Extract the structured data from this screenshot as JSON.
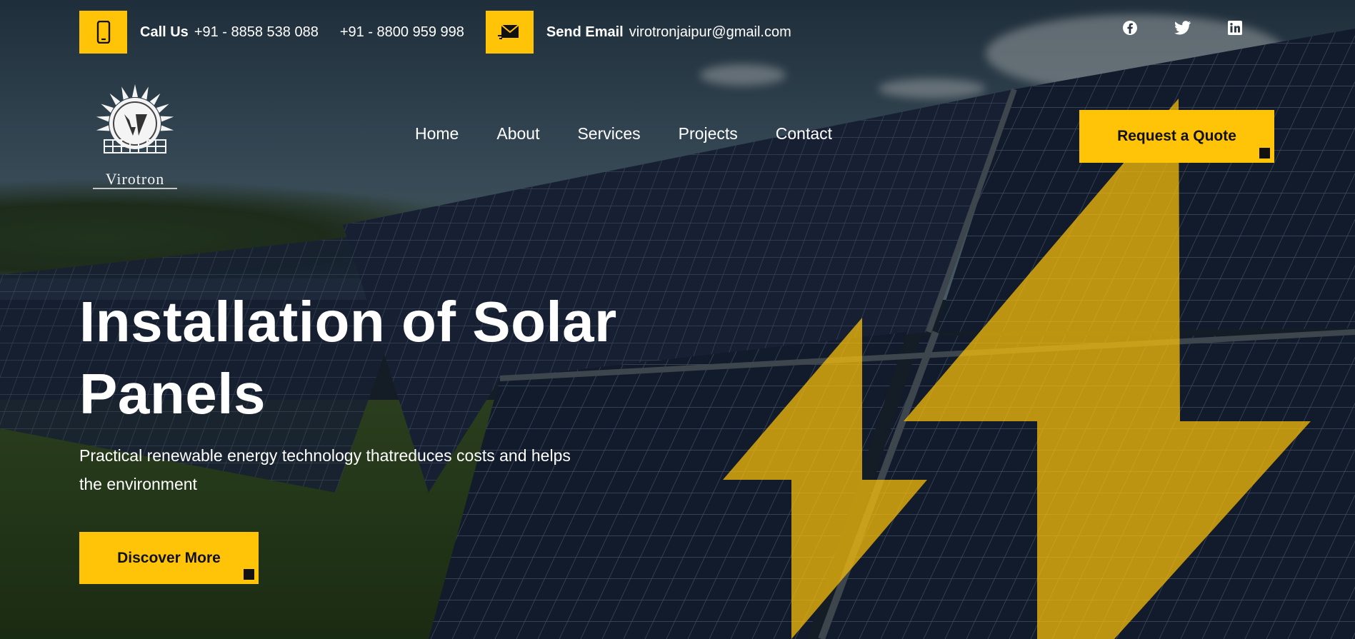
{
  "topbar": {
    "call_label": "Call Us",
    "phone_1": "+91 - 8858 538 088",
    "phone_2": "+91 - 8800 959 998",
    "email_label": "Send Email",
    "email": "virotronjaipur@gmail.com",
    "phone_icon": "phone-icon",
    "email_icon": "envelope-icon",
    "social": [
      {
        "icon": "facebook-icon"
      },
      {
        "icon": "twitter-icon"
      },
      {
        "icon": "linkedin-icon"
      }
    ]
  },
  "brand": {
    "logo_text": "Virotron"
  },
  "nav": {
    "items": [
      "Home",
      "About",
      "Services",
      "Projects",
      "Contact"
    ],
    "quote_label": "Request a Quote"
  },
  "hero": {
    "title_line1": "Installation of Solar",
    "title_line2": "Panels",
    "subtitle_line1": "Practical renewable energy technology thatreduces costs and helps",
    "subtitle_line2": "the environment",
    "cta_label": "Discover More"
  },
  "colors": {
    "accent": "#ffc408",
    "dark": "#111111",
    "text": "#ffffff"
  }
}
